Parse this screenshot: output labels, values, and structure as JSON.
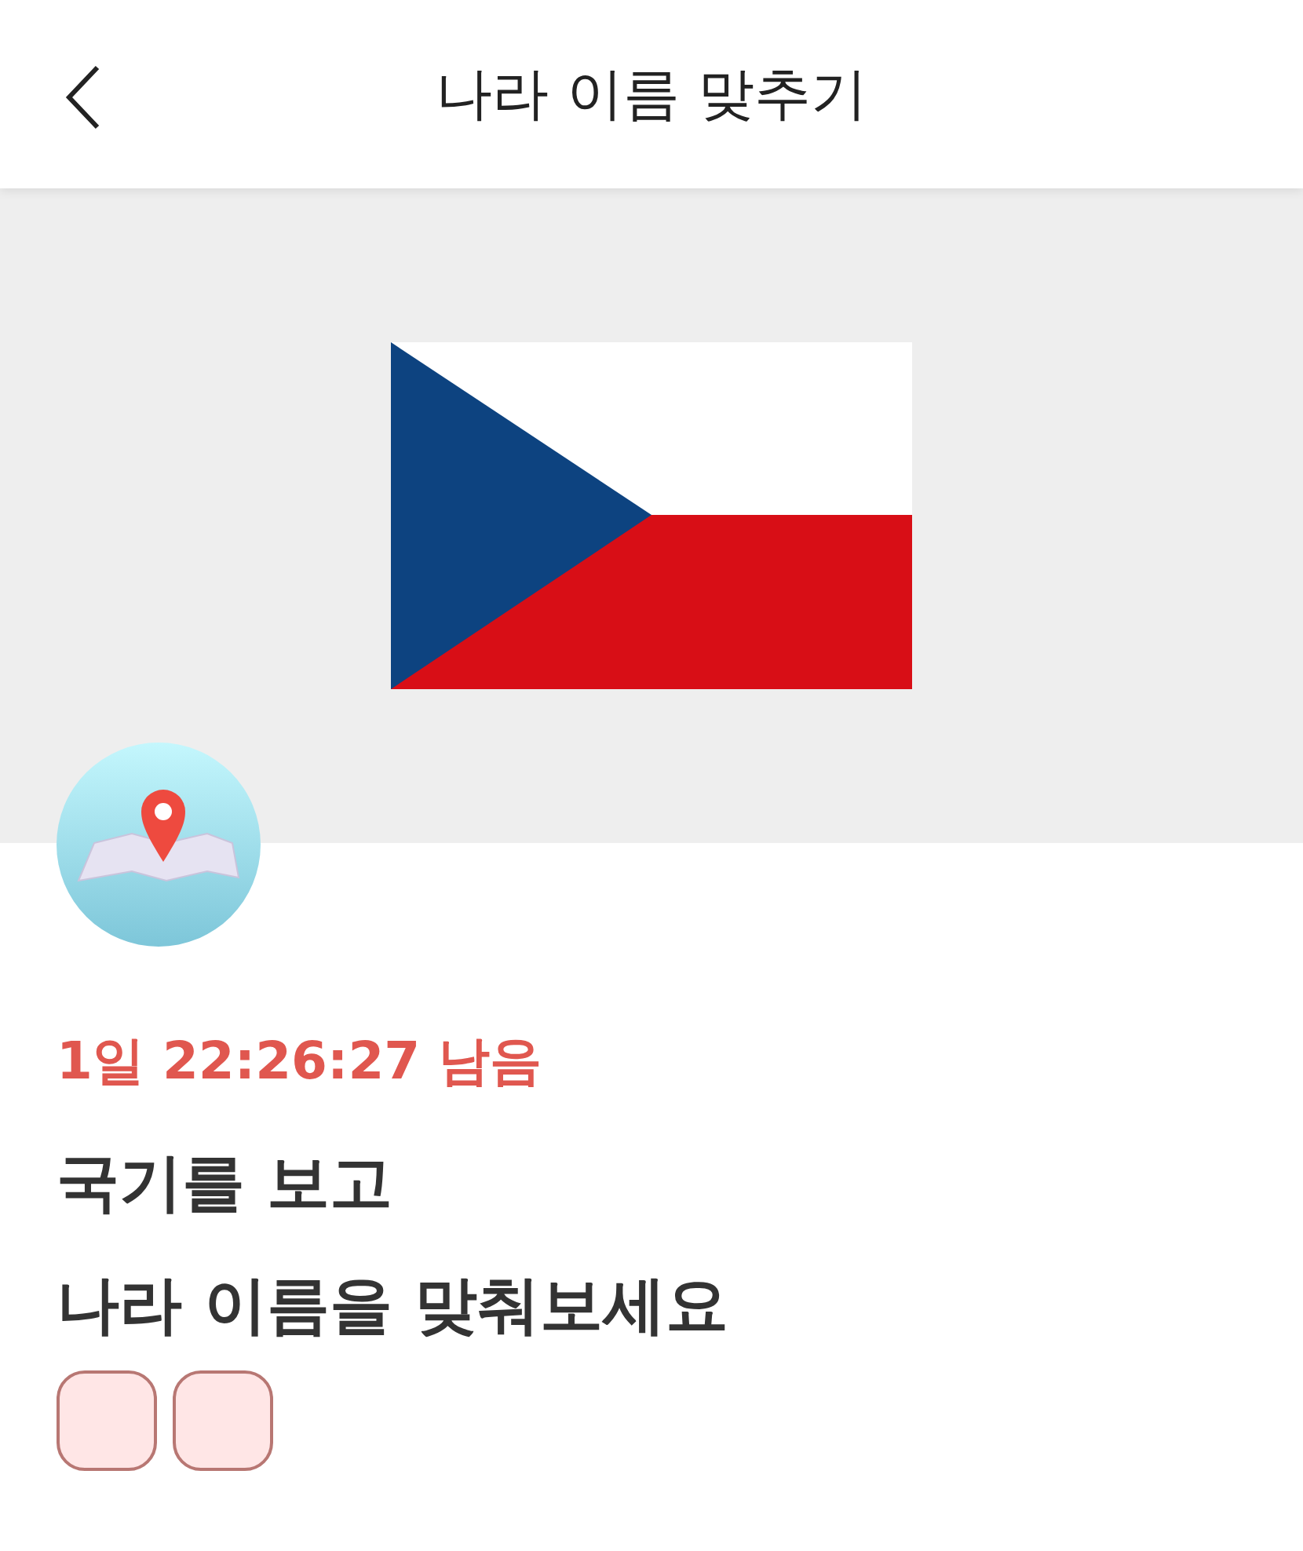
{
  "header": {
    "title": "나라 이름 맞추기"
  },
  "quiz": {
    "time_left": "1일 22:26:27 남음",
    "question_lines": [
      "국기를 보고",
      "나라 이름을 맞춰보세요"
    ],
    "answer_slots": [
      {
        "kind": "empty"
      },
      {
        "kind": "empty"
      }
    ]
  }
}
